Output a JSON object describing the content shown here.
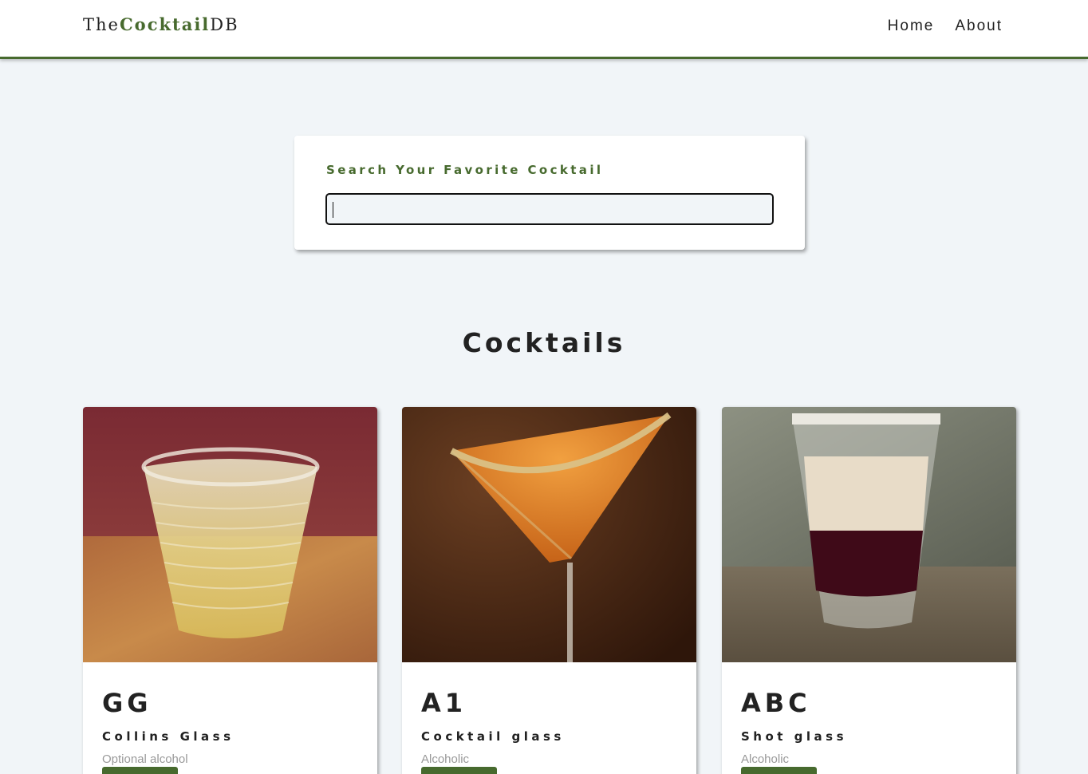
{
  "navbar": {
    "logo_pre": "The",
    "logo_mid": "Cocktail",
    "logo_post": "DB",
    "links": [
      {
        "label": "Home"
      },
      {
        "label": "About"
      }
    ]
  },
  "search": {
    "label": "Search Your Favorite Cocktail",
    "value": ""
  },
  "main": {
    "title": "Cocktails"
  },
  "colors": {
    "accent": "#476a2e",
    "background": "#f1f5f8"
  },
  "cocktails": [
    {
      "name": "GG",
      "glass": "Collins Glass",
      "info": "Optional alcohol"
    },
    {
      "name": "A1",
      "glass": "Cocktail glass",
      "info": "Alcoholic"
    },
    {
      "name": "ABC",
      "glass": "Shot glass",
      "info": "Alcoholic"
    }
  ]
}
